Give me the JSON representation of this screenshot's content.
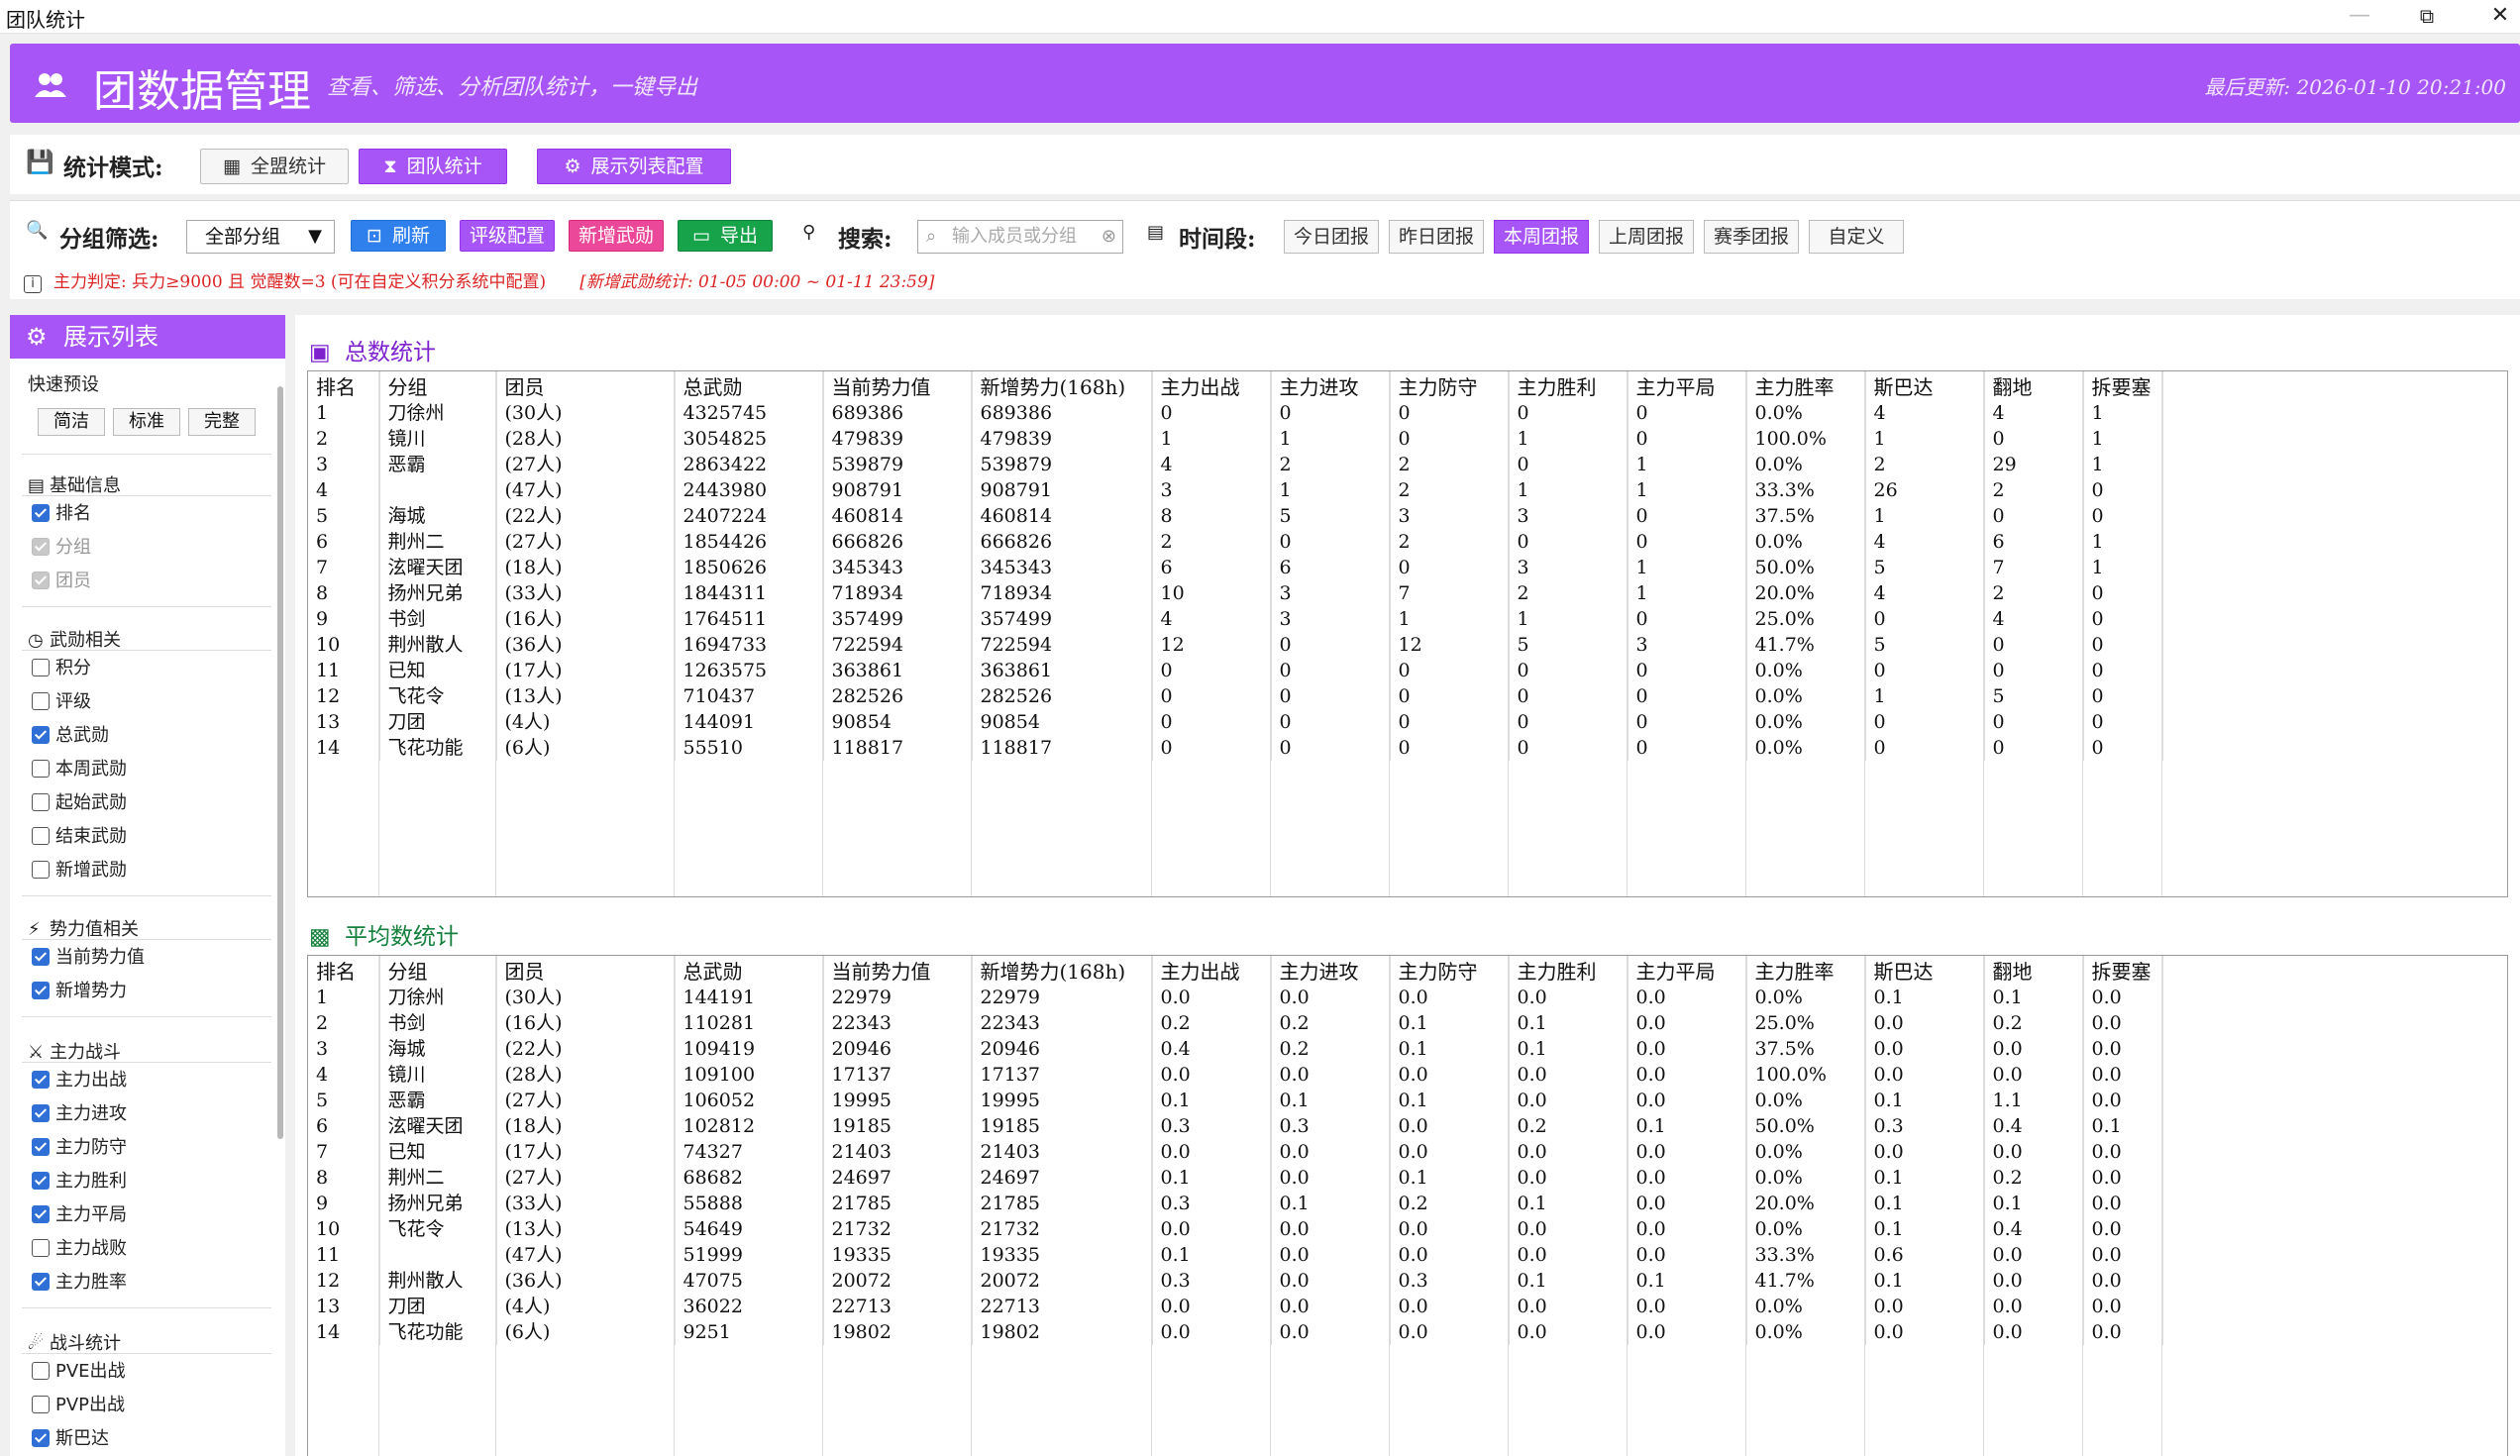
{
  "window": {
    "title": "团队统计"
  },
  "header": {
    "title": "团数据管理",
    "subtitle": "查看、筛选、分析团队统计，一键导出",
    "updated": "最后更新: 2026-01-10 20:21:00"
  },
  "mode": {
    "label": "统计模式:",
    "buttons": [
      "全盟统计",
      "团队统计",
      "展示列表配置"
    ]
  },
  "filter": {
    "label": "分组筛选:",
    "group_value": "全部分组",
    "refresh": "刷新",
    "rating": "评级配置",
    "add_merit": "新增武勋",
    "export": "导出",
    "search_label": "搜索:",
    "search_placeholder": "输入成员或分组",
    "time_label": "时间段:",
    "time_buttons": [
      "今日团报",
      "昨日团报",
      "本周团报",
      "上周团报",
      "赛季团报",
      "自定义"
    ],
    "note": "主力判定: 兵力≥9000 且 觉醒数=3 (可在自定义积分系统中配置)",
    "note_range": "[新增武勋统计: 01-05 00:00 ~ 01-11 23:59]"
  },
  "sidebar": {
    "title": "展示列表",
    "preset_label": "快速预设",
    "presets": [
      "简洁",
      "标准",
      "完整"
    ],
    "groups": [
      {
        "title": "基础信息",
        "items": [
          {
            "label": "排名",
            "state": "on"
          },
          {
            "label": "分组",
            "state": "dis"
          },
          {
            "label": "团员",
            "state": "dis"
          }
        ]
      },
      {
        "title": "武勋相关",
        "items": [
          {
            "label": "积分",
            "state": "off"
          },
          {
            "label": "评级",
            "state": "off"
          },
          {
            "label": "总武勋",
            "state": "on"
          },
          {
            "label": "本周武勋",
            "state": "off"
          },
          {
            "label": "起始武勋",
            "state": "off"
          },
          {
            "label": "结束武勋",
            "state": "off"
          },
          {
            "label": "新增武勋",
            "state": "off"
          }
        ]
      },
      {
        "title": "势力值相关",
        "items": [
          {
            "label": "当前势力值",
            "state": "on"
          },
          {
            "label": "新增势力",
            "state": "on"
          }
        ]
      },
      {
        "title": "主力战斗",
        "items": [
          {
            "label": "主力出战",
            "state": "on"
          },
          {
            "label": "主力进攻",
            "state": "on"
          },
          {
            "label": "主力防守",
            "state": "on"
          },
          {
            "label": "主力胜利",
            "state": "on"
          },
          {
            "label": "主力平局",
            "state": "on"
          },
          {
            "label": "主力战败",
            "state": "off"
          },
          {
            "label": "主力胜率",
            "state": "on"
          }
        ]
      },
      {
        "title": "战斗统计",
        "items": [
          {
            "label": "PVE出战",
            "state": "off"
          },
          {
            "label": "PVP出战",
            "state": "off"
          },
          {
            "label": "斯巴达",
            "state": "on"
          }
        ]
      }
    ]
  },
  "totals": {
    "title": "总数统计",
    "columns": [
      "排名",
      "分组",
      "团员",
      "总武勋",
      "当前势力值",
      "新增势力(168h)",
      "主力出战",
      "主力进攻",
      "主力防守",
      "主力胜利",
      "主力平局",
      "主力胜率",
      "斯巴达",
      "翻地",
      "拆要塞"
    ],
    "rows": [
      [
        "1",
        "刀徐州",
        "(30人)",
        "4325745",
        "689386",
        "689386",
        "0",
        "0",
        "0",
        "0",
        "0",
        "0.0%",
        "4",
        "4",
        "1"
      ],
      [
        "2",
        "镜川",
        "(28人)",
        "3054825",
        "479839",
        "479839",
        "1",
        "1",
        "0",
        "1",
        "0",
        "100.0%",
        "1",
        "0",
        "1"
      ],
      [
        "3",
        "恶霸",
        "(27人)",
        "2863422",
        "539879",
        "539879",
        "4",
        "2",
        "2",
        "0",
        "1",
        "0.0%",
        "2",
        "29",
        "1"
      ],
      [
        "4",
        "",
        "(47人)",
        "2443980",
        "908791",
        "908791",
        "3",
        "1",
        "2",
        "1",
        "1",
        "33.3%",
        "26",
        "2",
        "0"
      ],
      [
        "5",
        "海城",
        "(22人)",
        "2407224",
        "460814",
        "460814",
        "8",
        "5",
        "3",
        "3",
        "0",
        "37.5%",
        "1",
        "0",
        "0"
      ],
      [
        "6",
        "荆州二",
        "(27人)",
        "1854426",
        "666826",
        "666826",
        "2",
        "0",
        "2",
        "0",
        "0",
        "0.0%",
        "4",
        "6",
        "1"
      ],
      [
        "7",
        "泫曜天团",
        "(18人)",
        "1850626",
        "345343",
        "345343",
        "6",
        "6",
        "0",
        "3",
        "1",
        "50.0%",
        "5",
        "7",
        "1"
      ],
      [
        "8",
        "扬州兄弟",
        "(33人)",
        "1844311",
        "718934",
        "718934",
        "10",
        "3",
        "7",
        "2",
        "1",
        "20.0%",
        "4",
        "2",
        "0"
      ],
      [
        "9",
        "书剑",
        "(16人)",
        "1764511",
        "357499",
        "357499",
        "4",
        "3",
        "1",
        "1",
        "0",
        "25.0%",
        "0",
        "4",
        "0"
      ],
      [
        "10",
        "荆州散人",
        "(36人)",
        "1694733",
        "722594",
        "722594",
        "12",
        "0",
        "12",
        "5",
        "3",
        "41.7%",
        "5",
        "0",
        "0"
      ],
      [
        "11",
        "已知",
        "(17人)",
        "1263575",
        "363861",
        "363861",
        "0",
        "0",
        "0",
        "0",
        "0",
        "0.0%",
        "0",
        "0",
        "0"
      ],
      [
        "12",
        "飞花令",
        "(13人)",
        "710437",
        "282526",
        "282526",
        "0",
        "0",
        "0",
        "0",
        "0",
        "0.0%",
        "1",
        "5",
        "0"
      ],
      [
        "13",
        "刀团",
        "(4人)",
        "144091",
        "90854",
        "90854",
        "0",
        "0",
        "0",
        "0",
        "0",
        "0.0%",
        "0",
        "0",
        "0"
      ],
      [
        "14",
        "飞花功能",
        "(6人)",
        "55510",
        "118817",
        "118817",
        "0",
        "0",
        "0",
        "0",
        "0",
        "0.0%",
        "0",
        "0",
        "0"
      ]
    ]
  },
  "averages": {
    "title": "平均数统计",
    "columns": [
      "排名",
      "分组",
      "团员",
      "总武勋",
      "当前势力值",
      "新增势力(168h)",
      "主力出战",
      "主力进攻",
      "主力防守",
      "主力胜利",
      "主力平局",
      "主力胜率",
      "斯巴达",
      "翻地",
      "拆要塞"
    ],
    "rows": [
      [
        "1",
        "刀徐州",
        "(30人)",
        "144191",
        "22979",
        "22979",
        "0.0",
        "0.0",
        "0.0",
        "0.0",
        "0.0",
        "0.0%",
        "0.1",
        "0.1",
        "0.0"
      ],
      [
        "2",
        "书剑",
        "(16人)",
        "110281",
        "22343",
        "22343",
        "0.2",
        "0.2",
        "0.1",
        "0.1",
        "0.0",
        "25.0%",
        "0.0",
        "0.2",
        "0.0"
      ],
      [
        "3",
        "海城",
        "(22人)",
        "109419",
        "20946",
        "20946",
        "0.4",
        "0.2",
        "0.1",
        "0.1",
        "0.0",
        "37.5%",
        "0.0",
        "0.0",
        "0.0"
      ],
      [
        "4",
        "镜川",
        "(28人)",
        "109100",
        "17137",
        "17137",
        "0.0",
        "0.0",
        "0.0",
        "0.0",
        "0.0",
        "100.0%",
        "0.0",
        "0.0",
        "0.0"
      ],
      [
        "5",
        "恶霸",
        "(27人)",
        "106052",
        "19995",
        "19995",
        "0.1",
        "0.1",
        "0.1",
        "0.0",
        "0.0",
        "0.0%",
        "0.1",
        "1.1",
        "0.0"
      ],
      [
        "6",
        "泫曜天团",
        "(18人)",
        "102812",
        "19185",
        "19185",
        "0.3",
        "0.3",
        "0.0",
        "0.2",
        "0.1",
        "50.0%",
        "0.3",
        "0.4",
        "0.1"
      ],
      [
        "7",
        "已知",
        "(17人)",
        "74327",
        "21403",
        "21403",
        "0.0",
        "0.0",
        "0.0",
        "0.0",
        "0.0",
        "0.0%",
        "0.0",
        "0.0",
        "0.0"
      ],
      [
        "8",
        "荆州二",
        "(27人)",
        "68682",
        "24697",
        "24697",
        "0.1",
        "0.0",
        "0.1",
        "0.0",
        "0.0",
        "0.0%",
        "0.1",
        "0.2",
        "0.0"
      ],
      [
        "9",
        "扬州兄弟",
        "(33人)",
        "55888",
        "21785",
        "21785",
        "0.3",
        "0.1",
        "0.2",
        "0.1",
        "0.0",
        "20.0%",
        "0.1",
        "0.1",
        "0.0"
      ],
      [
        "10",
        "飞花令",
        "(13人)",
        "54649",
        "21732",
        "21732",
        "0.0",
        "0.0",
        "0.0",
        "0.0",
        "0.0",
        "0.0%",
        "0.1",
        "0.4",
        "0.0"
      ],
      [
        "11",
        "",
        "(47人)",
        "51999",
        "19335",
        "19335",
        "0.1",
        "0.0",
        "0.0",
        "0.0",
        "0.0",
        "33.3%",
        "0.6",
        "0.0",
        "0.0"
      ],
      [
        "12",
        "荆州散人",
        "(36人)",
        "47075",
        "20072",
        "20072",
        "0.3",
        "0.0",
        "0.3",
        "0.1",
        "0.1",
        "41.7%",
        "0.1",
        "0.0",
        "0.0"
      ],
      [
        "13",
        "刀团",
        "(4人)",
        "36022",
        "22713",
        "22713",
        "0.0",
        "0.0",
        "0.0",
        "0.0",
        "0.0",
        "0.0%",
        "0.0",
        "0.0",
        "0.0"
      ],
      [
        "14",
        "飞花功能",
        "(6人)",
        "9251",
        "19802",
        "19802",
        "0.0",
        "0.0",
        "0.0",
        "0.0",
        "0.0",
        "0.0%",
        "0.0",
        "0.0",
        "0.0"
      ]
    ]
  },
  "colors": {
    "accent": "#a855f7",
    "blue": "#2f80ed",
    "pink": "#ec4899",
    "green": "#16a34a",
    "note": "#dc2626"
  }
}
